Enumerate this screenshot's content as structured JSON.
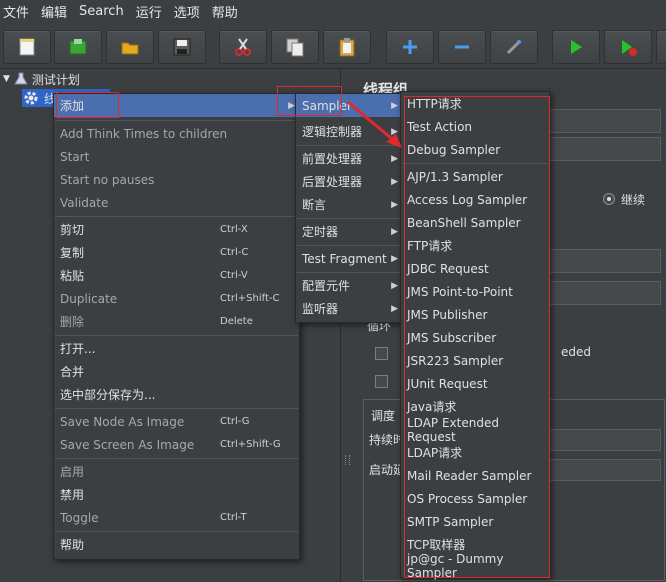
{
  "menubar": [
    "文件",
    "编辑",
    "Search",
    "运行",
    "选项",
    "帮助"
  ],
  "toolbar_icons": [
    "new-icon",
    "templates-icon",
    "open-icon",
    "save-icon",
    "cut-icon",
    "copy-icon",
    "paste-icon",
    "expand-icon",
    "collapse-icon",
    "toggle-icon",
    "start-icon",
    "start-no-pauses-icon"
  ],
  "tree": {
    "root": "测试计划",
    "child": "线程组"
  },
  "right_panel": {
    "title": "线程组",
    "radio_label": "继续",
    "label_loop": "循环",
    "checkbox_tail": "eded",
    "label_scheduler": "调度",
    "label_duration": "持续时",
    "label_startup": "启动延"
  },
  "context_menu": {
    "items": [
      {
        "label": "添加",
        "shortcut": "",
        "submenu": true,
        "disabled": false
      },
      {
        "label": "Add Think Times to children",
        "shortcut": "",
        "disabled": true
      },
      {
        "label": "Start",
        "shortcut": "",
        "disabled": true
      },
      {
        "label": "Start no pauses",
        "shortcut": "",
        "disabled": true
      },
      {
        "label": "Validate",
        "shortcut": "",
        "disabled": true
      },
      {
        "label": "剪切",
        "shortcut": "Ctrl-X",
        "disabled": false
      },
      {
        "label": "复制",
        "shortcut": "Ctrl-C",
        "disabled": false
      },
      {
        "label": "粘贴",
        "shortcut": "Ctrl-V",
        "disabled": false
      },
      {
        "label": "Duplicate",
        "shortcut": "Ctrl+Shift-C",
        "disabled": true
      },
      {
        "label": "删除",
        "shortcut": "Delete",
        "disabled": true
      },
      {
        "label": "打开...",
        "shortcut": "",
        "disabled": false
      },
      {
        "label": "合并",
        "shortcut": "",
        "disabled": false
      },
      {
        "label": "选中部分保存为...",
        "shortcut": "",
        "disabled": false
      },
      {
        "label": "Save Node As Image",
        "shortcut": "Ctrl-G",
        "disabled": true
      },
      {
        "label": "Save Screen As Image",
        "shortcut": "Ctrl+Shift-G",
        "disabled": true
      },
      {
        "label": "启用",
        "shortcut": "",
        "disabled": true
      },
      {
        "label": "禁用",
        "shortcut": "",
        "disabled": false
      },
      {
        "label": "Toggle",
        "shortcut": "Ctrl-T",
        "disabled": true
      },
      {
        "label": "帮助",
        "shortcut": "",
        "disabled": false
      }
    ]
  },
  "add_submenu": {
    "items": [
      "Sampler",
      "逻辑控制器",
      "前置处理器",
      "后置处理器",
      "断言",
      "定时器",
      "Test Fragment",
      "配置元件",
      "监听器"
    ]
  },
  "sampler_submenu": {
    "items": [
      "HTTP请求",
      "Test Action",
      "Debug Sampler",
      "AJP/1.3 Sampler",
      "Access Log Sampler",
      "BeanShell Sampler",
      "FTP请求",
      "JDBC Request",
      "JMS Point-to-Point",
      "JMS Publisher",
      "JMS Subscriber",
      "JSR223 Sampler",
      "JUnit Request",
      "Java请求",
      "LDAP Extended Request",
      "LDAP请求",
      "Mail Reader Sampler",
      "OS Process Sampler",
      "SMTP Sampler",
      "TCP取样器",
      "jp@gc - Dummy Sampler"
    ]
  },
  "colors": {
    "background": "#3c3f41",
    "highlight": "#4b6eaf",
    "annotation": "#e0292d"
  }
}
